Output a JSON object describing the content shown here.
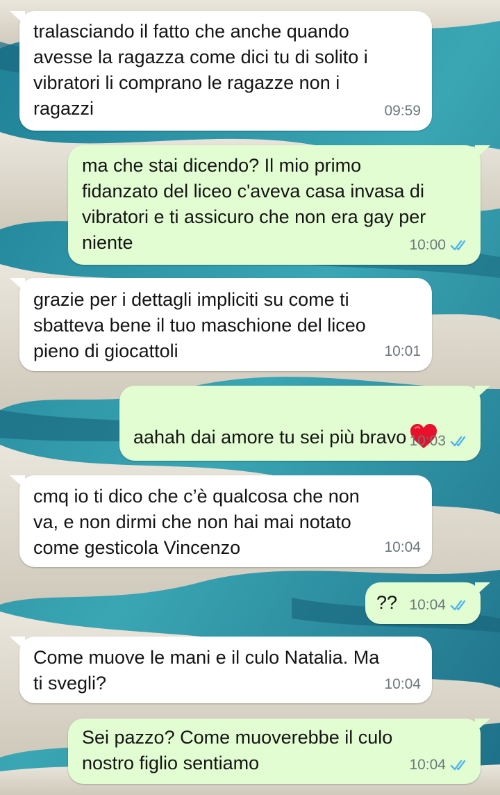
{
  "messages": [
    {
      "direction": "incoming",
      "text": "tralasciando il fatto che anche quando\navesse la ragazza come dici tu di solito i\nvibratori li comprano le ragazze non i\nragazzi",
      "time": "09:59"
    },
    {
      "direction": "outgoing",
      "text": "ma che stai dicendo? Il mio primo\nfidanzato del liceo c'aveva casa invasa di\nvibratori e ti assicuro che non era gay per\nniente",
      "time": "10:00",
      "status": "read"
    },
    {
      "direction": "incoming",
      "text": "grazie per i dettagli impliciti su come ti\nsbatteva bene il tuo maschione del liceo\npieno di giocattoli",
      "time": "10:01"
    },
    {
      "direction": "outgoing",
      "text": "aahah dai amore tu sei più bravo",
      "emoji": "heart-icon",
      "time": "10:03",
      "status": "read"
    },
    {
      "direction": "incoming",
      "text": "cmq io ti dico che c’è qualcosa che non\nva, e non dirmi che non hai mai notato\ncome gesticola Vincenzo",
      "time": "10:04"
    },
    {
      "direction": "outgoing",
      "text": "??",
      "time": "10:04",
      "status": "read"
    },
    {
      "direction": "incoming",
      "text": "Come muove le mani e il culo Natalia. Ma\nti svegli?",
      "time": "10:04"
    },
    {
      "direction": "outgoing",
      "text": "Sei pazzo? Come muoverebbe il culo\nnostro figlio sentiamo",
      "time": "10:04",
      "status": "read"
    }
  ],
  "colors": {
    "incoming_bubble": "#ffffff",
    "outgoing_bubble": "#e2fdd2",
    "read_ticks": "#4fb6ec",
    "timestamp": "#6d777c",
    "heart": "#e8102a"
  }
}
